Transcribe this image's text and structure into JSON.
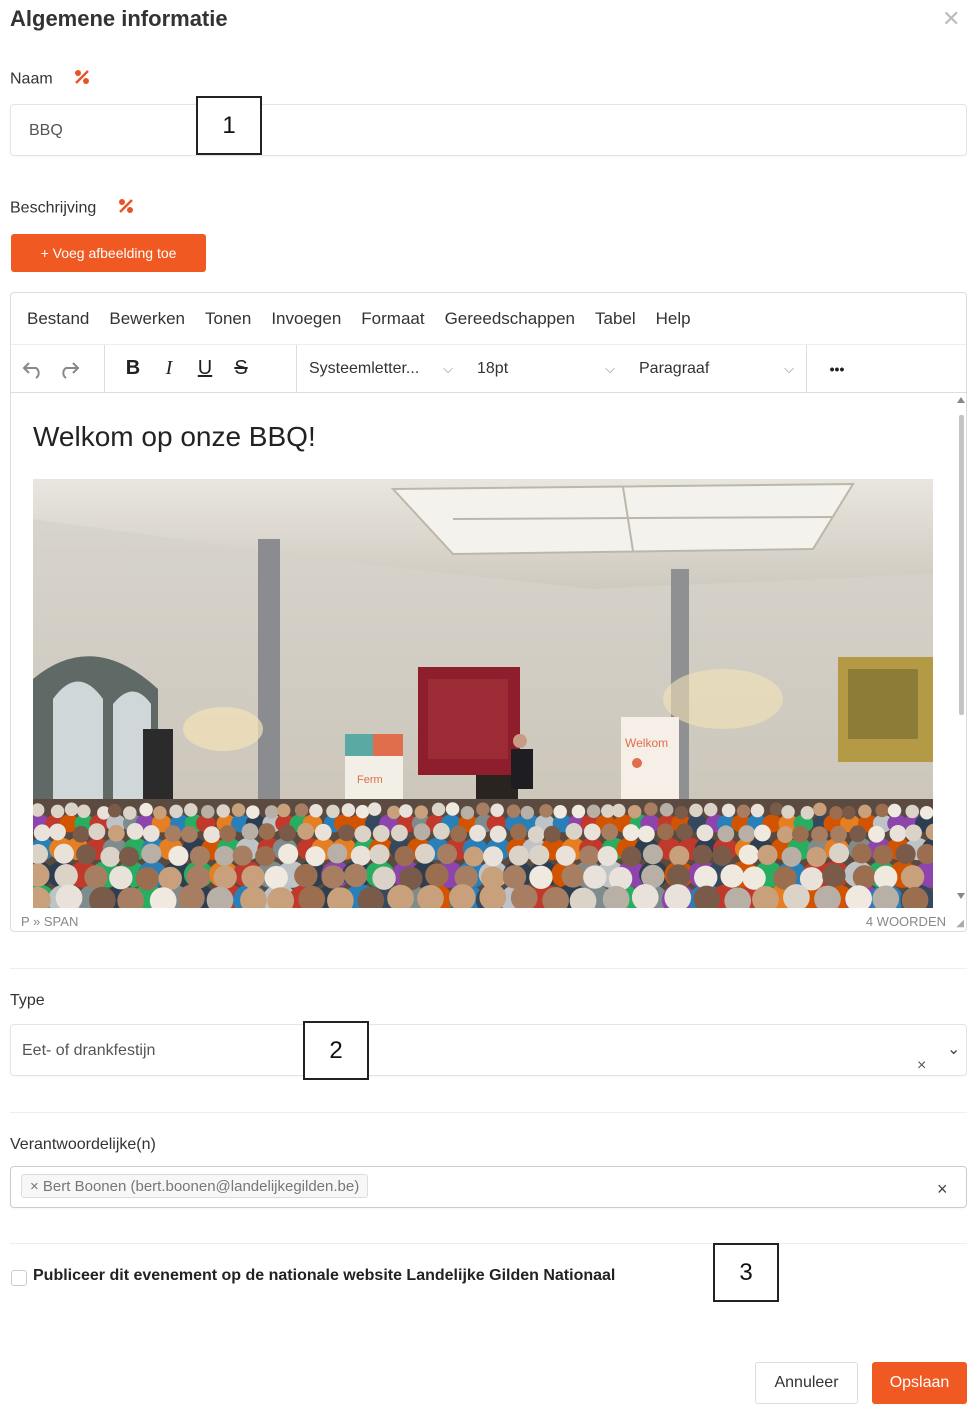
{
  "modal": {
    "title": "Algemene informatie",
    "close_icon": "close-icon"
  },
  "name_field": {
    "label": "Naam",
    "value": "BBQ",
    "marker": "1"
  },
  "description_field": {
    "label": "Beschrijving",
    "add_image_button": "+ Voeg afbeelding toe"
  },
  "editor": {
    "menu": [
      "Bestand",
      "Bewerken",
      "Tonen",
      "Invoegen",
      "Formaat",
      "Gereedschappen",
      "Tabel",
      "Help"
    ],
    "toolbar": {
      "bold": "B",
      "italic": "I",
      "underline": "U",
      "strikethrough": "S",
      "font_family": "Systeemletter...",
      "font_size": "18pt",
      "block_format": "Paragraaf",
      "more": "•••"
    },
    "content_heading": "Welkom op onze BBQ!",
    "photo_banner_text": "Welkom",
    "photo_left_banner_text": "Ferm",
    "status_path": "P » SPAN",
    "word_count": "4 WOORDEN"
  },
  "type_field": {
    "label": "Type",
    "value": "Eet- of drankfestijn",
    "marker": "2"
  },
  "responsible_field": {
    "label": "Verantwoordelijke(n)",
    "tag": "× Bert Boonen (bert.boonen@landelijkegilden.be)"
  },
  "publish": {
    "label": "Publiceer dit evenement op de nationale website Landelijke Gilden Nationaal",
    "checked": false,
    "marker": "3"
  },
  "footer": {
    "cancel_label": "Annuleer",
    "save_label": "Opslaan"
  },
  "colors": {
    "accent": "#f05a22",
    "translate_icon": "#e8542a"
  }
}
